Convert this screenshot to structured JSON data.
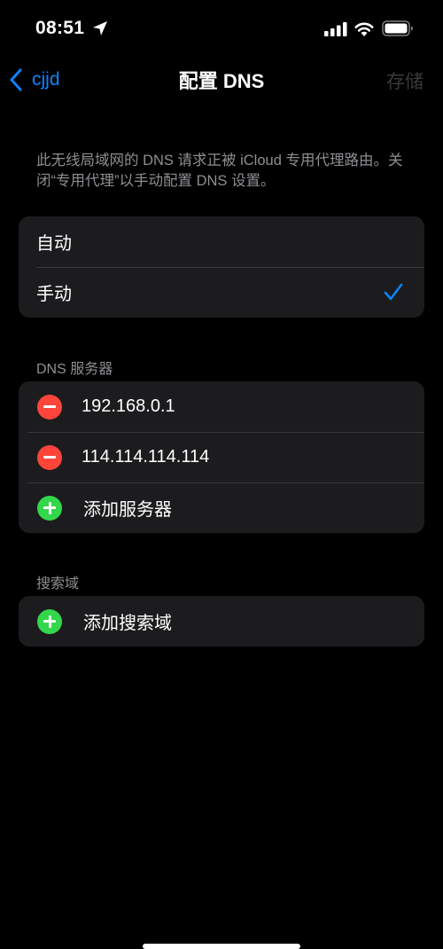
{
  "status": {
    "time": "08:51"
  },
  "nav": {
    "back_label": "cjjd",
    "title": "配置 DNS",
    "save_label": "存储"
  },
  "info_text": "此无线局域网的 DNS 请求正被 iCloud 专用代理路由。关闭“专用代理”以手动配置 DNS 设置。",
  "mode": {
    "options": [
      {
        "label": "自动",
        "selected": false
      },
      {
        "label": "手动",
        "selected": true
      }
    ]
  },
  "dns_servers": {
    "header": "DNS 服务器",
    "servers": [
      "192.168.0.1",
      "114.114.114.114"
    ],
    "add_label": "添加服务器"
  },
  "search_domains": {
    "header": "搜索域",
    "add_label": "添加搜索域"
  },
  "colors": {
    "accent": "#0a84ff",
    "delete": "#ff453a",
    "add": "#32d74b",
    "cell_bg": "#1c1c1e",
    "secondary_text": "#8e8e93"
  },
  "icons": [
    "location-arrow-icon",
    "cellular-signal-icon",
    "wifi-icon",
    "battery-icon",
    "chevron-left-icon",
    "checkmark-icon",
    "minus-circle-icon",
    "plus-circle-icon"
  ]
}
